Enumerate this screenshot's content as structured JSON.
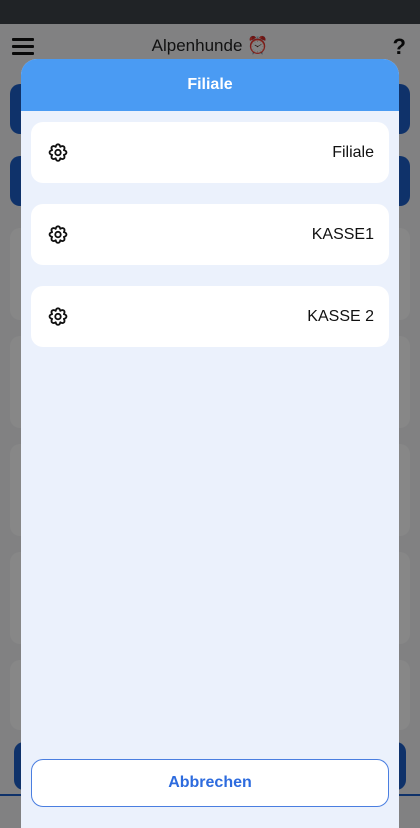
{
  "background": {
    "header_title": "Alpenhunde",
    "help_label": "?"
  },
  "dialog": {
    "title": "Filiale",
    "items": [
      {
        "label": "Filiale",
        "icon": "gear-icon"
      },
      {
        "label": "KASSE1",
        "icon": "gear-icon"
      },
      {
        "label": "KASSE 2",
        "icon": "gear-icon"
      }
    ],
    "cancel_label": "Abbrechen"
  },
  "colors": {
    "header_blue": "#4a9bf3",
    "dialog_bg": "#ebf1fc",
    "accent": "#2d6bde"
  }
}
